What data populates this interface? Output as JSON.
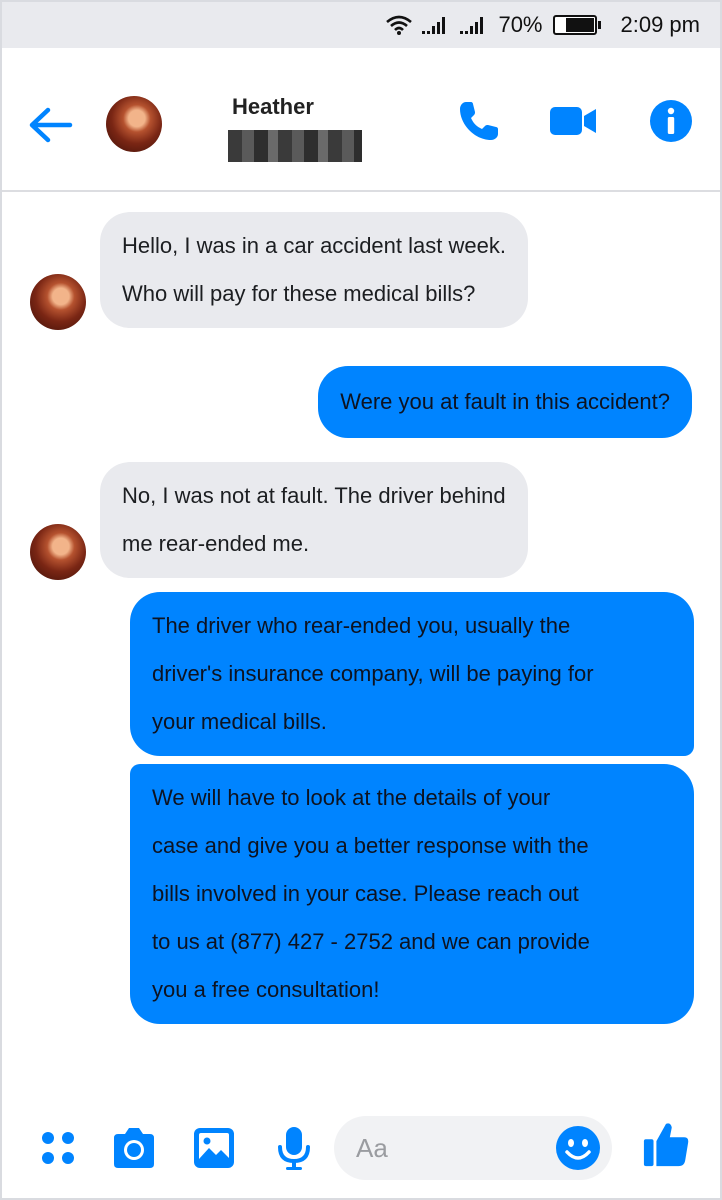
{
  "status_bar": {
    "battery": "70%",
    "time": "2:09 pm"
  },
  "header": {
    "contact_name": "Heather",
    "back_icon": "arrow-left-icon",
    "call_icon": "phone-icon",
    "video_icon": "video-camera-icon",
    "info_icon": "info-icon"
  },
  "messages": [
    {
      "direction": "incoming",
      "lines": [
        "Hello, I was in a car accident last week.",
        "Who will pay for these medical bills?"
      ]
    },
    {
      "direction": "outgoing",
      "lines": [
        "Were you at fault in this accident?"
      ]
    },
    {
      "direction": "incoming",
      "lines": [
        "No, I was not at fault. The driver behind",
        "me rear-ended me."
      ]
    },
    {
      "direction": "outgoing",
      "lines": [
        "The driver who rear-ended you, usually the",
        "driver's insurance company, will be paying for",
        "your medical bills."
      ]
    },
    {
      "direction": "outgoing",
      "lines": [
        "We will have to look at the details of your",
        "case and give you a better response with the",
        "bills involved in your case. Please reach out",
        "to us at (877) 427 - 2752 and we can provide",
        "you a free consultation!"
      ]
    }
  ],
  "composer": {
    "placeholder": "Aa",
    "icons": [
      "apps-icon",
      "camera-icon",
      "image-icon",
      "microphone-icon",
      "emoji-icon",
      "thumbs-up-icon"
    ]
  },
  "colors": {
    "accent": "#0084ff",
    "incoming_bubble": "#e9eaee",
    "status_bar": "#e9eaee"
  }
}
